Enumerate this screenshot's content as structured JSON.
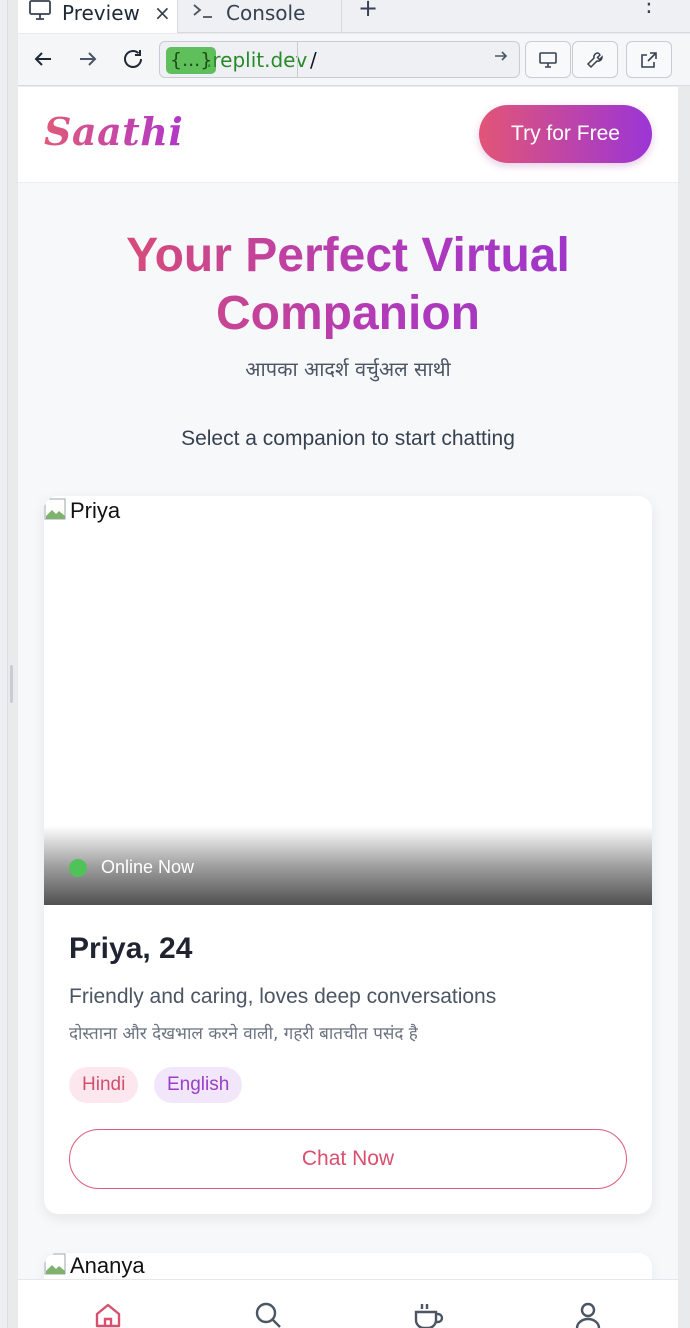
{
  "browser": {
    "tabs": [
      {
        "label": "Preview",
        "close": "×"
      },
      {
        "label": "Console"
      }
    ],
    "new_tab": "+",
    "menu": "⋮",
    "url": {
      "pill": "{...}",
      "host": ".replit.dev",
      "path": "/"
    }
  },
  "app": {
    "logo": "Saathi",
    "cta": "Try for Free",
    "hero": {
      "title_line1": "Your Perfect Virtual",
      "title_line2": "Companion",
      "subtitle": "आपका आदर्श वर्चुअल साथी",
      "prompt": "Select a companion to start chatting"
    },
    "companions": [
      {
        "img_alt": "Priya",
        "status": "Online Now",
        "name": "Priya, 24",
        "description": "Friendly and caring, loves deep conversations",
        "description_hi": "दोस्ताना और देखभाल करने वाली, गहरी बातचीत पसंद है",
        "languages": [
          "Hindi",
          "English"
        ],
        "action": "Chat Now"
      },
      {
        "img_alt": "Ananya"
      }
    ],
    "bottom_nav": [
      {
        "icon": "home-icon",
        "active": true
      },
      {
        "icon": "search-icon"
      },
      {
        "icon": "coffee-cup-icon"
      },
      {
        "icon": "user-icon"
      }
    ],
    "colors": {
      "brand_pink": "#e05a7a",
      "brand_purple": "#9b35d6",
      "online": "#4fc35a"
    }
  }
}
